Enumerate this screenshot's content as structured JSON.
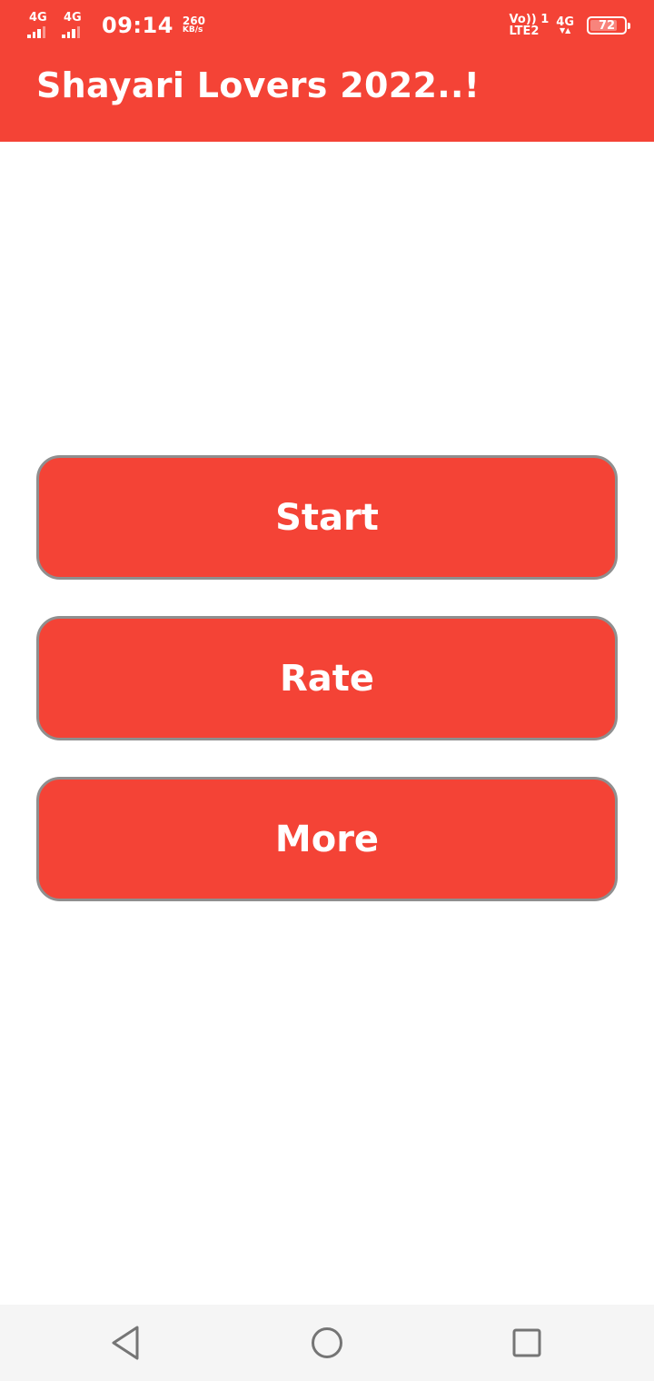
{
  "status_bar": {
    "sim1_network": "4G",
    "sim2_network": "4G",
    "time": "09:14",
    "speed_value": "260",
    "speed_unit": "KB/s",
    "volte_line1": "Vo)) 1",
    "volte_line2": "LTE2",
    "data_network": "4G",
    "battery_level": "72"
  },
  "app_bar": {
    "title": "Shayari Lovers 2022..!"
  },
  "menu": {
    "start_label": "Start",
    "rate_label": "Rate",
    "more_label": "More"
  },
  "colors": {
    "primary": "#F44336",
    "button_border": "#8F8F8F",
    "nav_bar": "#F5F5F5",
    "nav_icon": "#757575"
  },
  "nav_bar": {
    "icons": [
      "back-icon",
      "home-icon",
      "recents-icon"
    ]
  }
}
